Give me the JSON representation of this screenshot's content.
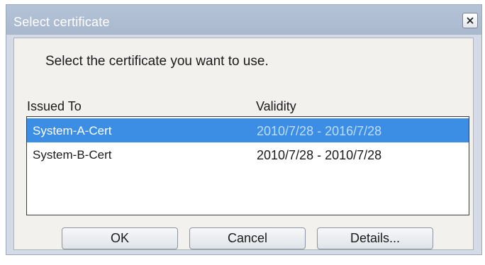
{
  "dialog": {
    "title": "Select certificate",
    "prompt": "Select the certificate you want to use."
  },
  "table": {
    "columns": [
      "Issued To",
      "Validity"
    ],
    "rows": [
      {
        "issued_to": "System-A-Cert",
        "validity": "2010/7/28 - 2016/7/28",
        "selected": true
      },
      {
        "issued_to": "System-B-Cert",
        "validity": "2010/7/28 - 2010/7/28",
        "selected": false
      }
    ]
  },
  "buttons": {
    "ok": "OK",
    "cancel": "Cancel",
    "details": "Details..."
  },
  "icons": {
    "close": "close-icon"
  },
  "colors": {
    "selection": "#3c8ee4",
    "title_bar": "#b5c3d8"
  }
}
